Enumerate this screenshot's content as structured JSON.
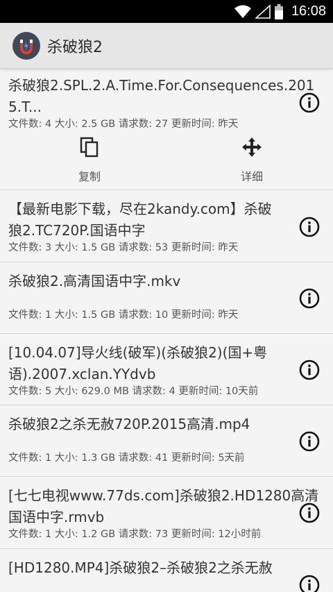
{
  "status_bar": {
    "time": "16:08"
  },
  "app_bar": {
    "title": "杀破狼2"
  },
  "items": [
    {
      "title": "杀破狼2.SPL.2.A.Time.For.Consequences.2015.T...",
      "meta": "文件数: 4 大小: 2.5 GB 请求数: 27 更新时间: 昨天",
      "actions": [
        {
          "label": "复制",
          "icon": "copy-icon"
        },
        {
          "label": "详细",
          "icon": "move-arrows-icon"
        }
      ]
    },
    {
      "title": "【最新电影下载，尽在2kandy.com】杀破狼2.TC720P.国语中字",
      "meta": "文件数: 3 大小: 1.5 GB 请求数: 53 更新时间: 昨天"
    },
    {
      "title": "杀破狼2.高清国语中字.mkv",
      "meta": "文件数: 1 大小: 1.5 GB 请求数: 10 更新时间: 昨天"
    },
    {
      "title": "[10.04.07]导火线(破军)(杀破狼2)(国+粤语).2007.xclan.YYdvb",
      "meta": "文件数: 5 大小: 629.0 MB 请求数: 4 更新时间: 10天前"
    },
    {
      "title": "杀破狼2之杀无赦720P.2015高清.mp4",
      "meta": "文件数: 1 大小: 1.3 GB 请求数: 41 更新时间: 5天前"
    },
    {
      "title": "[七七电视www.77ds.com]杀破狼2.HD1280高清国语中字.rmvb",
      "meta": "文件数: 1 大小: 1.2 GB 请求数: 73 更新时间: 12小时前"
    },
    {
      "title": "[HD1280.MP4]杀破狼2–杀破狼2之杀无赦",
      "meta": ""
    }
  ]
}
